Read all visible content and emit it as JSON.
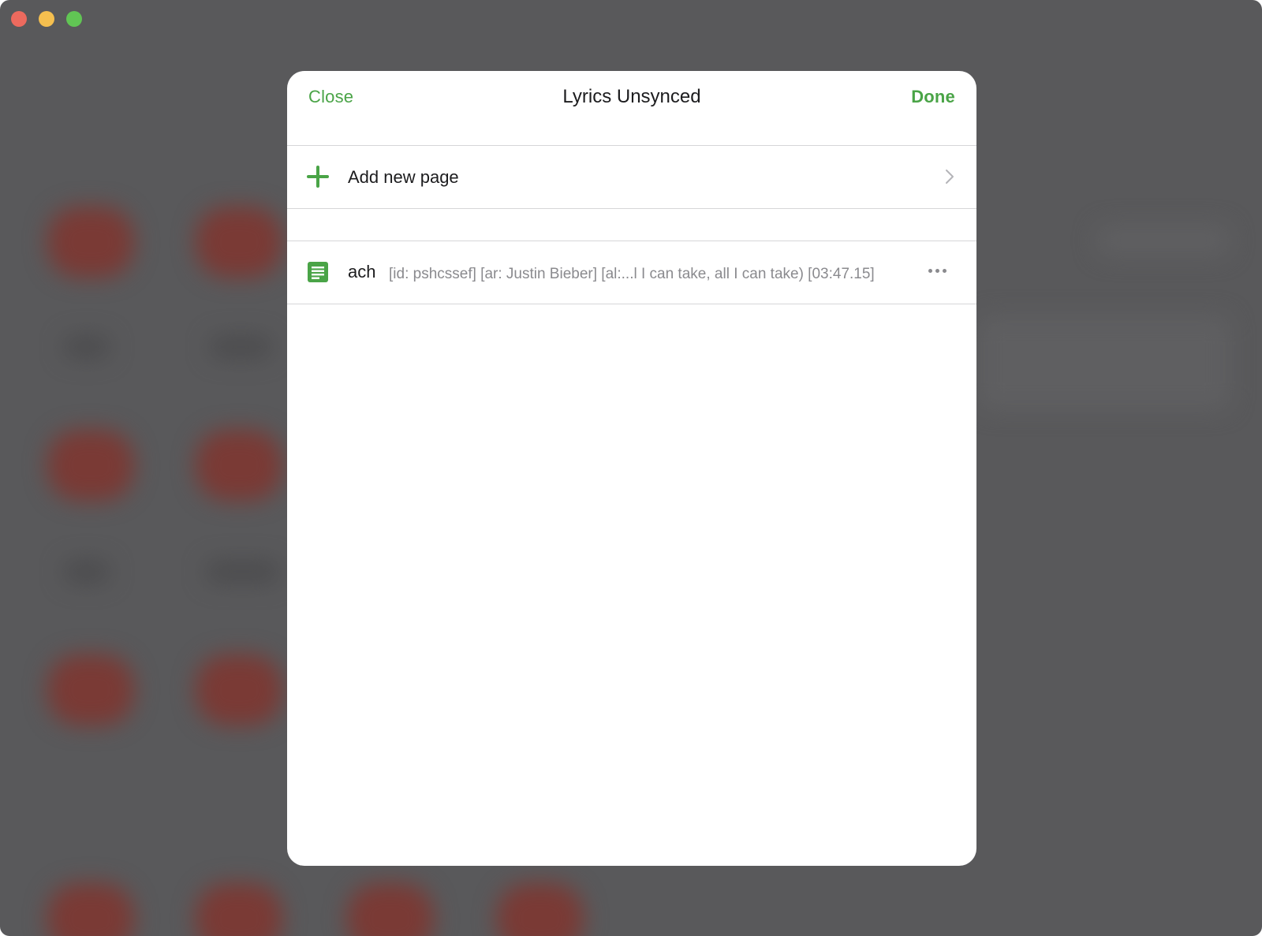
{
  "window": {
    "traffic_lights": [
      "close",
      "minimize",
      "maximize"
    ],
    "colors": {
      "close": "#ed6a5e",
      "minimize": "#f5bf4f",
      "maximize": "#61c554",
      "background": "#59595b"
    }
  },
  "sheet": {
    "title": "Lyrics Unsynced",
    "close_label": "Close",
    "done_label": "Done",
    "accent_color": "#4aa447",
    "add_row": {
      "label": "Add new page",
      "icon": "plus-icon",
      "trailing_icon": "chevron-right-icon"
    },
    "pages": [
      {
        "name": "ach",
        "meta": "[id: pshcssef] [ar: Justin Bieber] [al:...l I can take, all I can take) [03:47.15]",
        "icon": "document-icon",
        "action_icon": "more-icon"
      }
    ]
  }
}
